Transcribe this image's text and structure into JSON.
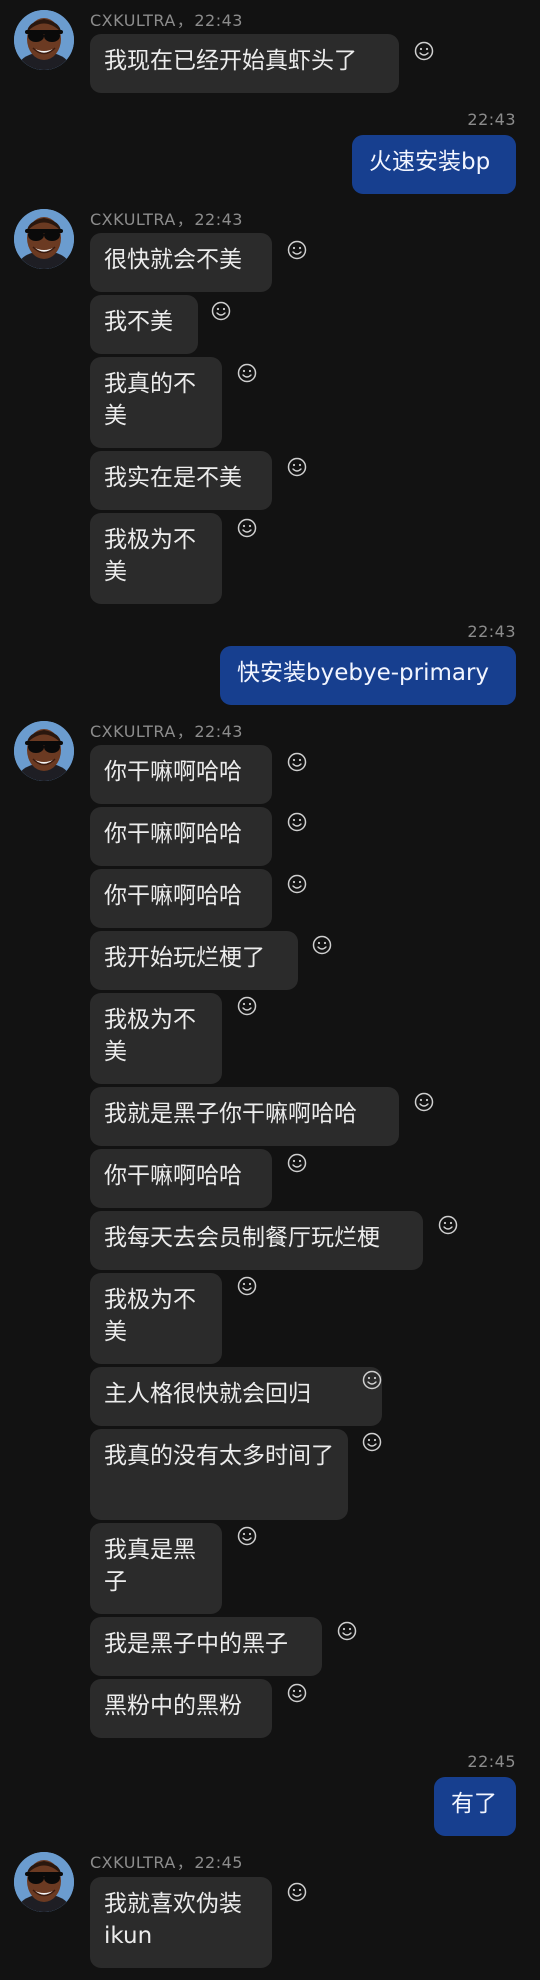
{
  "sender": {
    "name": "CXKULTRA",
    "sep": "，"
  },
  "groups": [
    {
      "time": "22:43",
      "messages": [
        "我现在已经开始真虾头了"
      ]
    },
    {
      "time": "22:43",
      "messages": [
        "很快就会不美",
        "我不美",
        "我真的不美",
        "我实在是不美",
        "我极为不美"
      ]
    },
    {
      "time": "22:43",
      "messages": [
        "你干嘛啊哈哈",
        "你干嘛啊哈哈",
        "你干嘛啊哈哈",
        "我开始玩烂梗了",
        "我极为不美",
        "我就是黑子你干嘛啊哈哈",
        "你干嘛啊哈哈",
        "我每天去会员制餐厅玩烂梗",
        "我极为不美",
        "主人格很快就会回归",
        "我真的没有太多时间了",
        "我真是黑子",
        "我是黑子中的黑子",
        "黑粉中的黑粉"
      ]
    },
    {
      "time": "22:45",
      "messages": [
        "我就喜欢伪装ikun"
      ]
    }
  ],
  "outgoing": [
    {
      "time": "22:43",
      "text": "火速安装bp"
    },
    {
      "time": "22:43",
      "text": "快安装byebye-primary"
    },
    {
      "time": "22:45",
      "text": "有了"
    }
  ],
  "icons": {
    "reaction": "smiley-add-reaction-icon",
    "avatar": "avatar-sunglasses"
  },
  "colors": {
    "background": "#121212",
    "incoming_bubble": "#2b2b2b",
    "outgoing_bubble": "#173f8f",
    "meta_text": "#8c8c8c"
  }
}
